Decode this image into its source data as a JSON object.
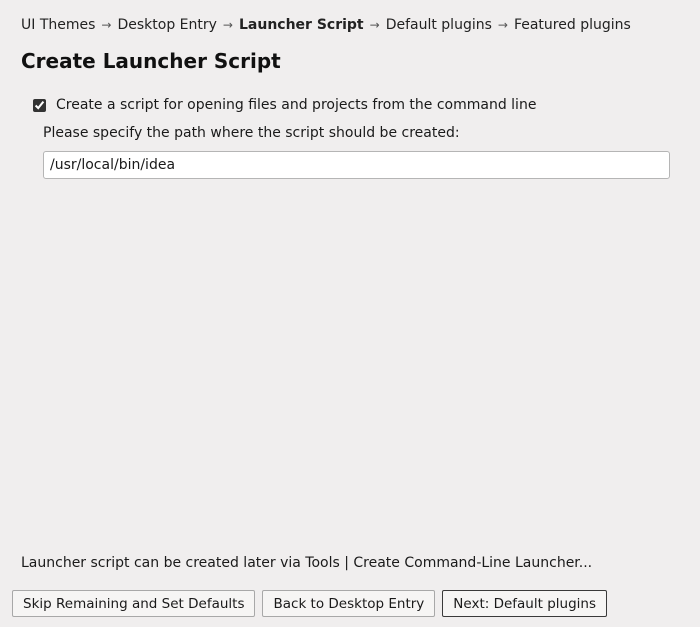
{
  "breadcrumb": {
    "items": [
      {
        "label": "UI Themes",
        "current": false
      },
      {
        "label": "Desktop Entry",
        "current": false
      },
      {
        "label": "Launcher Script",
        "current": true
      },
      {
        "label": "Default plugins",
        "current": false
      },
      {
        "label": "Featured plugins",
        "current": false
      }
    ]
  },
  "page_title": "Create Launcher Script",
  "form": {
    "checkbox_label": "Create a script for opening files and projects from the command line",
    "checkbox_checked": true,
    "path_hint": "Please specify the path where the script should be created:",
    "path_value": "/usr/local/bin/idea"
  },
  "footer_note": "Launcher script can be created later via Tools | Create Command-Line Launcher...",
  "buttons": {
    "skip": "Skip Remaining and Set Defaults",
    "back": "Back to Desktop Entry",
    "next": "Next: Default plugins"
  }
}
